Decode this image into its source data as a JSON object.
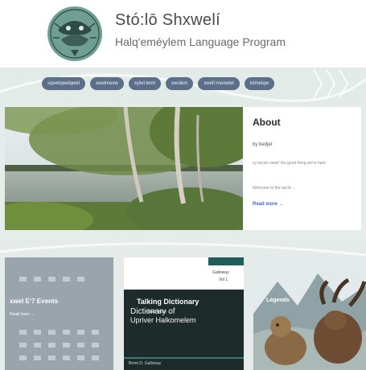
{
  "header": {
    "title": "Stó:lō Shxwelí",
    "subtitle": "Halq'eméylem Language Program"
  },
  "nav": {
    "items": [
      {
        "label": "sqwelqwelqwel"
      },
      {
        "label": "xwelmexw"
      },
      {
        "label": "syiwì:lemt"
      },
      {
        "label": "xwolem"
      },
      {
        "label": "xwelì:mexwtel"
      },
      {
        "label": "lolmelqw"
      }
    ]
  },
  "featured": {
    "about_title": "About",
    "by_line": "by bedjet",
    "excerpt": "xy kw'els sweti' ths good thing we're here",
    "excerpt2": "Welcome to the tas:lē ...",
    "read_more": "Read more →"
  },
  "cards": [
    {
      "title": "xwel Eʼ7 Events",
      "read_more": "Read more →"
    },
    {
      "title": "Talking Dictionary",
      "read_more": "Read more →",
      "book_title_line1": "Dictionary of",
      "book_title_line2": "Upriver Halkomelem",
      "book_author": "Brent D. Galloway",
      "spine_1": "Galloway",
      "spine_2": "Vol 1"
    },
    {
      "title": "Legends"
    }
  ],
  "colors": {
    "nav_pill": "#5b6f8a",
    "accent_link": "#3b6bc4",
    "band": "#e3ebe9"
  }
}
